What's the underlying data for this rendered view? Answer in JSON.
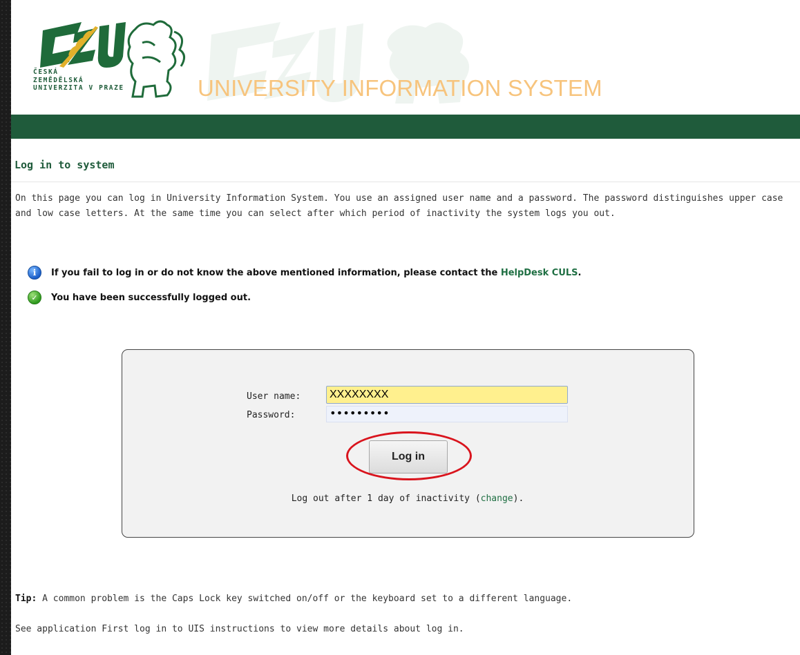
{
  "header": {
    "logo_lines": [
      "ČESKÁ",
      "ZEMĚDĚLSKÁ",
      "UNIVERZITA V PRAZE"
    ],
    "system_title": "UNIVERSITY INFORMATION SYSTEM",
    "brand_green": "#1f5b3b",
    "title_color": "#f7c47d"
  },
  "page": {
    "title": "Log in to system",
    "intro": "On this page you can log in University Information System. You use an assigned user name and a password. The password distinguishes upper case and low case letters. At the same time you can select after which period of inactivity the system logs you out.",
    "messages": {
      "info_text": "If you fail to log in or do not know the above mentioned information, please contact the ",
      "info_link": "HelpDesk CULS",
      "info_end": ".",
      "success_text": "You have been successfully logged out."
    }
  },
  "login": {
    "user_label": "User name:",
    "user_value": "XXXXXXXX",
    "password_label": "Password:",
    "password_value": "•••••••••",
    "button_label": "Log in",
    "logout_prefix": "Log out after 1 day of inactivity (",
    "logout_link": "change",
    "logout_suffix": ")."
  },
  "footer": {
    "tip_label": "Tip:",
    "tip_text": " A common problem is the Caps Lock key switched on/off or the keyboard set to a different language.",
    "see_also": "See application First log in to UIS instructions to view more details about log in."
  }
}
